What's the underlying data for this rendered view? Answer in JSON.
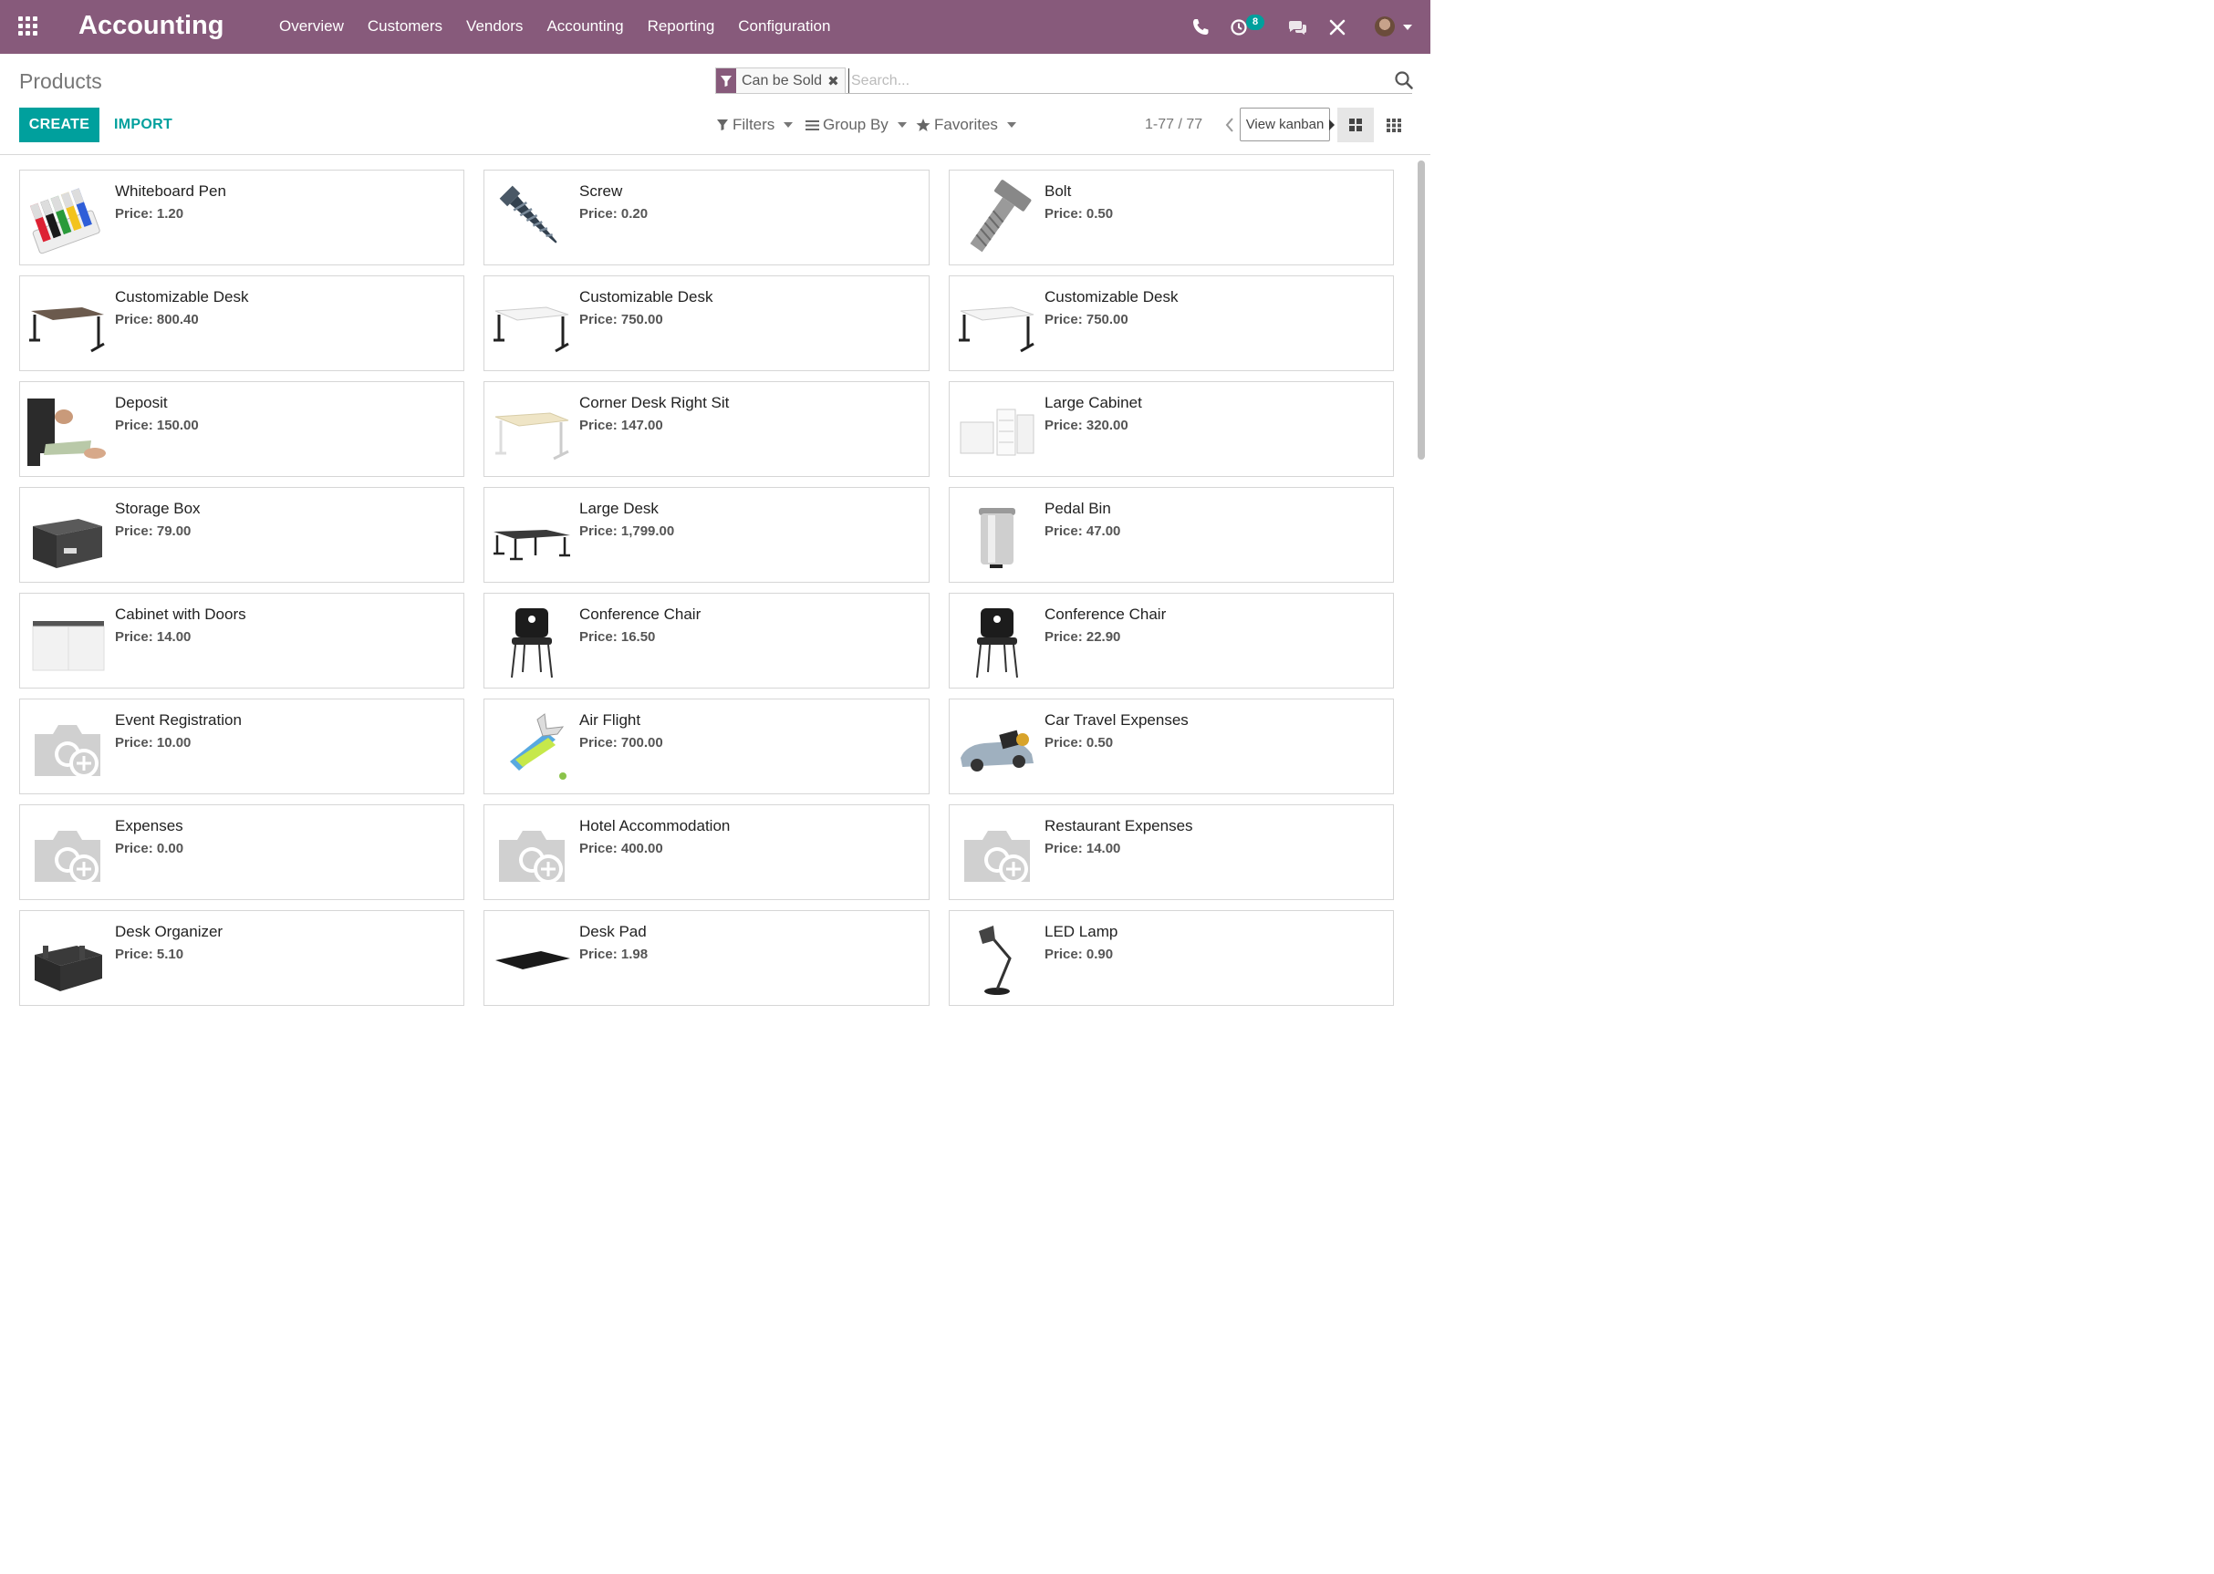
{
  "navbar": {
    "app_title": "Accounting",
    "menu": [
      "Overview",
      "Customers",
      "Vendors",
      "Accounting",
      "Reporting",
      "Configuration"
    ],
    "activity_count": "8"
  },
  "control_panel": {
    "title": "Products",
    "create_label": "CREATE",
    "import_label": "IMPORT",
    "facet_label": "Can be Sold",
    "facet_remove": "✖",
    "search_placeholder": "Search...",
    "filters_label": "Filters",
    "groupby_label": "Group By",
    "favorites_label": "Favorites",
    "pager": "1-77 / 77",
    "tooltip": "View kanban"
  },
  "colors": {
    "brand": "#875a7b",
    "primary": "#00a09d"
  },
  "products": [
    {
      "name": "Whiteboard Pen",
      "price": "Price: 1.20",
      "image": "whiteboard-pen"
    },
    {
      "name": "Screw",
      "price": "Price: 0.20",
      "image": "screw"
    },
    {
      "name": "Bolt",
      "price": "Price: 0.50",
      "image": "bolt"
    },
    {
      "name": "Customizable Desk",
      "price": "Price: 800.40",
      "image": "desk-dark"
    },
    {
      "name": "Customizable Desk",
      "price": "Price: 750.00",
      "image": "desk-white"
    },
    {
      "name": "Customizable Desk",
      "price": "Price: 750.00",
      "image": "desk-white"
    },
    {
      "name": "Deposit",
      "price": "Price: 150.00",
      "image": "deposit"
    },
    {
      "name": "Corner Desk Right Sit",
      "price": "Price: 147.00",
      "image": "desk-light"
    },
    {
      "name": "Large Cabinet",
      "price": "Price: 320.00",
      "image": "cabinet-white"
    },
    {
      "name": "Storage Box",
      "price": "Price: 79.00",
      "image": "storage-box"
    },
    {
      "name": "Large Desk",
      "price": "Price: 1,799.00",
      "image": "large-desk"
    },
    {
      "name": "Pedal Bin",
      "price": "Price: 47.00",
      "image": "pedal-bin"
    },
    {
      "name": "Cabinet with Doors",
      "price": "Price: 14.00",
      "image": "cabinet-doors"
    },
    {
      "name": "Conference Chair",
      "price": "Price: 16.50",
      "image": "chair"
    },
    {
      "name": "Conference Chair",
      "price": "Price: 22.90",
      "image": "chair"
    },
    {
      "name": "Event Registration",
      "price": "Price: 10.00",
      "image": "placeholder"
    },
    {
      "name": "Air Flight",
      "price": "Price: 700.00",
      "image": "air-flight"
    },
    {
      "name": "Car Travel Expenses",
      "price": "Price: 0.50",
      "image": "car"
    },
    {
      "name": "Expenses",
      "price": "Price: 0.00",
      "image": "placeholder"
    },
    {
      "name": "Hotel Accommodation",
      "price": "Price: 400.00",
      "image": "placeholder"
    },
    {
      "name": "Restaurant Expenses",
      "price": "Price: 14.00",
      "image": "placeholder"
    },
    {
      "name": "Desk Organizer",
      "price": "Price: 5.10",
      "image": "desk-organizer"
    },
    {
      "name": "Desk Pad",
      "price": "Price: 1.98",
      "image": "desk-pad"
    },
    {
      "name": "LED Lamp",
      "price": "Price: 0.90",
      "image": "led-lamp"
    }
  ]
}
